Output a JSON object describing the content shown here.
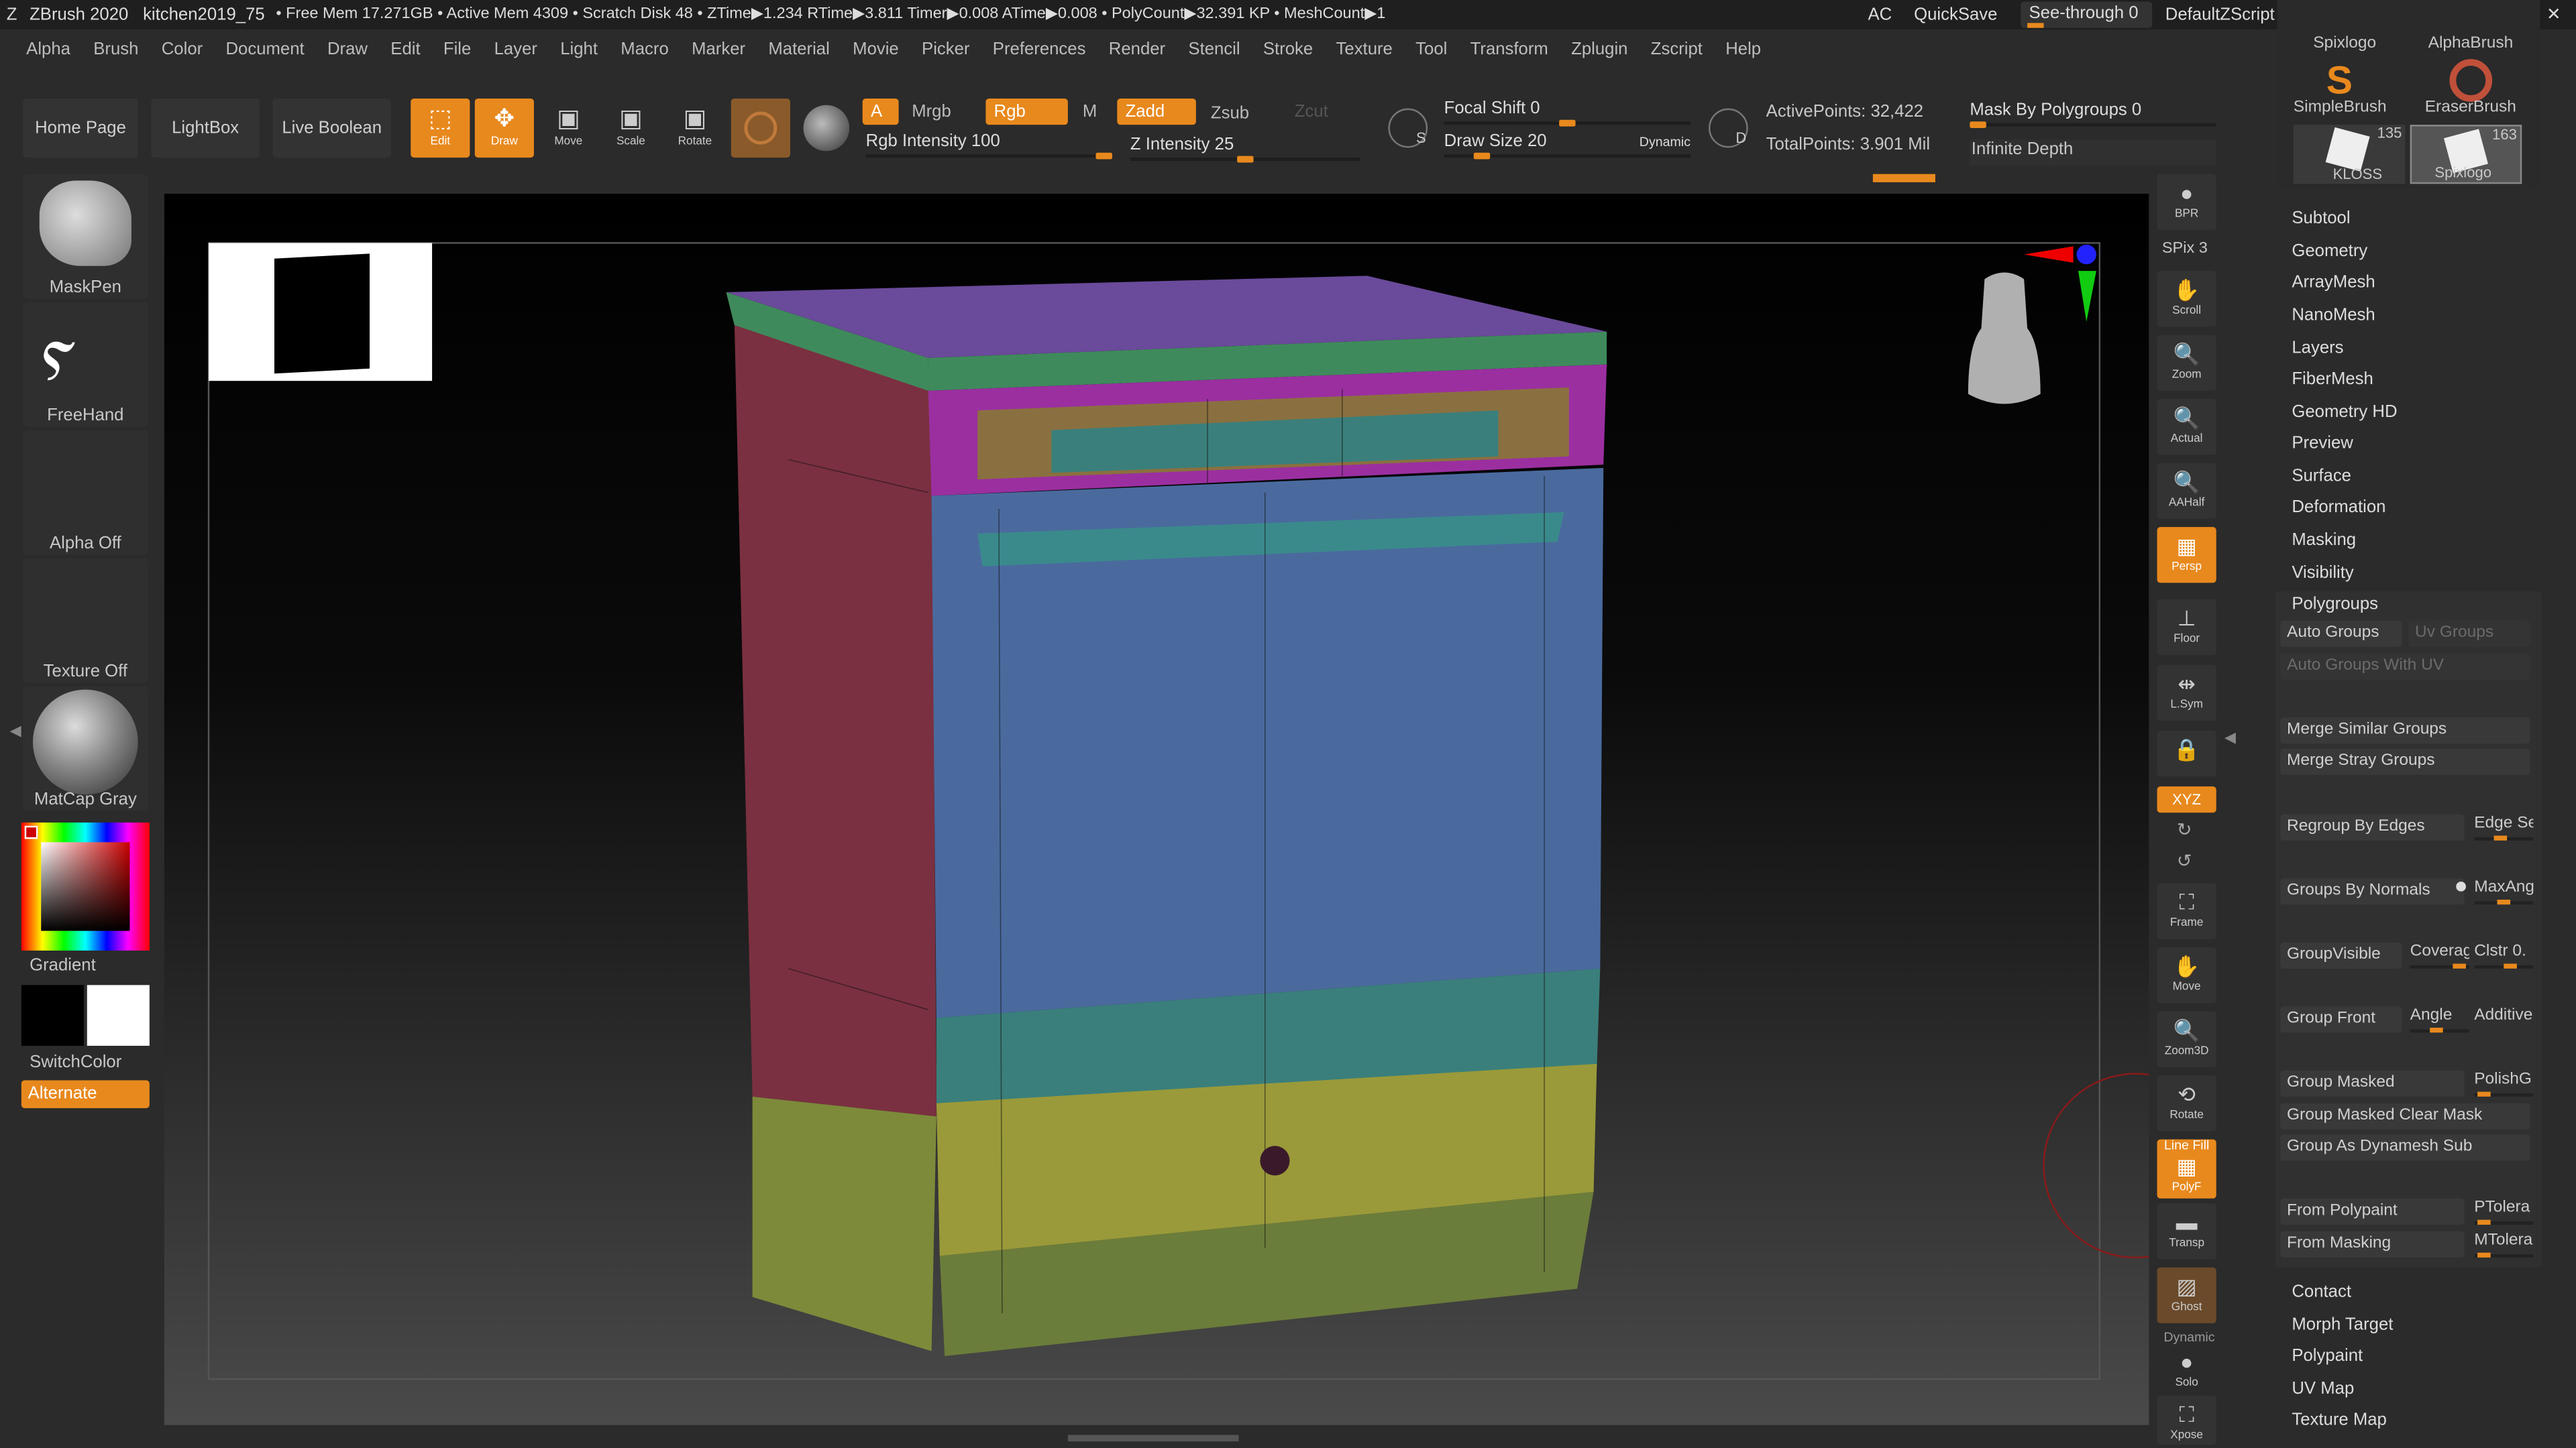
{
  "titlebar": {
    "app": "ZBrush 2020",
    "project": "kitchen2019_75",
    "stats": "• Free Mem 17.271GB • Active Mem 4309 • Scratch Disk 48 • ZTime▶1.234 RTime▶3.811 Timer▶0.008 ATime▶0.008 • PolyCount▶32.391 KP • MeshCount▶1",
    "ac": "AC",
    "quicksave": "QuickSave",
    "seethrough": "See-through 0",
    "script": "DefaultZScript"
  },
  "menu": [
    "Alpha",
    "Brush",
    "Color",
    "Document",
    "Draw",
    "Edit",
    "File",
    "Layer",
    "Light",
    "Macro",
    "Marker",
    "Material",
    "Movie",
    "Picker",
    "Preferences",
    "Render",
    "Stencil",
    "Stroke",
    "Texture",
    "Tool",
    "Transform",
    "Zplugin",
    "Zscript",
    "Help"
  ],
  "shelf": {
    "home": "Home Page",
    "lightbox": "LightBox",
    "live_boolean": "Live Boolean",
    "edit": "Edit",
    "draw": "Draw",
    "move": "Move",
    "scale": "Scale",
    "rotate": "Rotate",
    "a": "A",
    "mrgb": "Mrgb",
    "rgb": "Rgb",
    "m": "M",
    "zadd": "Zadd",
    "zsub": "Zsub",
    "zcut": "Zcut",
    "rgb_intensity": "Rgb Intensity 100",
    "z_intensity": "Z Intensity 25",
    "focal_shift": "Focal Shift 0",
    "draw_size": "Draw Size 20",
    "dynamic": "Dynamic",
    "s": "S",
    "d": "D",
    "active_points": "ActivePoints: 32,422",
    "total_points": "TotalPoints: 3.901 Mil",
    "mask_polygroups": "Mask By Polygroups 0",
    "infinite_depth": "Infinite Depth"
  },
  "left": {
    "brush": "MaskPen",
    "stroke": "FreeHand",
    "alpha": "Alpha Off",
    "texture": "Texture Off",
    "material": "MatCap Gray",
    "gradient": "Gradient",
    "switch": "SwitchColor",
    "alternate": "Alternate"
  },
  "vtoolbar": [
    {
      "label": "BPR"
    },
    {
      "label": "Scroll"
    },
    {
      "label": "Zoom"
    },
    {
      "label": "Actual"
    },
    {
      "label": "AAHalf"
    },
    {
      "label": "Persp"
    },
    {
      "label": "Floor"
    },
    {
      "label": "L.Sym"
    },
    {
      "label": "Frame"
    },
    {
      "label": "Move"
    },
    {
      "label": "Zoom3D"
    },
    {
      "label": "Rotate"
    },
    {
      "label": "PolyF"
    },
    {
      "label": "Transp"
    },
    {
      "label": "Ghost"
    },
    {
      "label": "Solo"
    },
    {
      "label": "Xpose"
    }
  ],
  "spix": "SPix 3",
  "xyz": "XYZ",
  "lineFill": "Line Fill",
  "dynamicLabel": "Dynamic",
  "tools": {
    "spix_logo_top": "Spixlogo",
    "alphabrush": "AlphaBrush",
    "simplebrush": "SimpleBrush",
    "eraserbrush": "EraserBrush",
    "kloss": "KLOSS",
    "kloss_count": "135",
    "spixlogo": "Spixlogo",
    "spixlogo_count": "163"
  },
  "subpalettes": [
    "Subtool",
    "Geometry",
    "ArrayMesh",
    "NanoMesh",
    "Layers",
    "FiberMesh",
    "Geometry HD",
    "Preview",
    "Surface",
    "Deformation",
    "Masking",
    "Visibility",
    "Polygroups"
  ],
  "polygroups": {
    "auto_groups": "Auto Groups",
    "uv_groups": "Uv Groups",
    "auto_groups_uv": "Auto Groups With UV",
    "merge_similar": "Merge Similar Groups",
    "merge_stray": "Merge Stray Groups",
    "regroup_edges": "Regroup By Edges",
    "edge_se": "Edge Se",
    "groups_normals": "Groups By Normals",
    "maxang": "MaxAng",
    "group_visible": "GroupVisible",
    "coverage": "Coverag",
    "clstr": "Clstr 0.",
    "group_front": "Group Front",
    "angle": "Angle",
    "additive": "Additive",
    "group_masked": "Group Masked",
    "polishg": "PolishG",
    "group_masked_clear": "Group Masked Clear Mask",
    "group_dynamesh": "Group As Dynamesh Sub",
    "from_polypaint": "From Polypaint",
    "ptolera": "PTolera",
    "from_masking": "From Masking",
    "mtolera": "MTolera"
  },
  "subpalettes_bottom": [
    "Contact",
    "Morph Target",
    "Polypaint",
    "UV Map",
    "Texture Map"
  ],
  "colors": {
    "accent": "#e8891d",
    "top_green": "#3f8a5c",
    "top_purple": "#6a4a9a",
    "drawer_magenta": "#9b2fa0",
    "door_blue": "#4a6a9e",
    "side_red": "#7a3040",
    "toe_yellow": "#8a8a3a",
    "base_olive": "#6b7d3a",
    "teal": "#3a7f7c"
  }
}
